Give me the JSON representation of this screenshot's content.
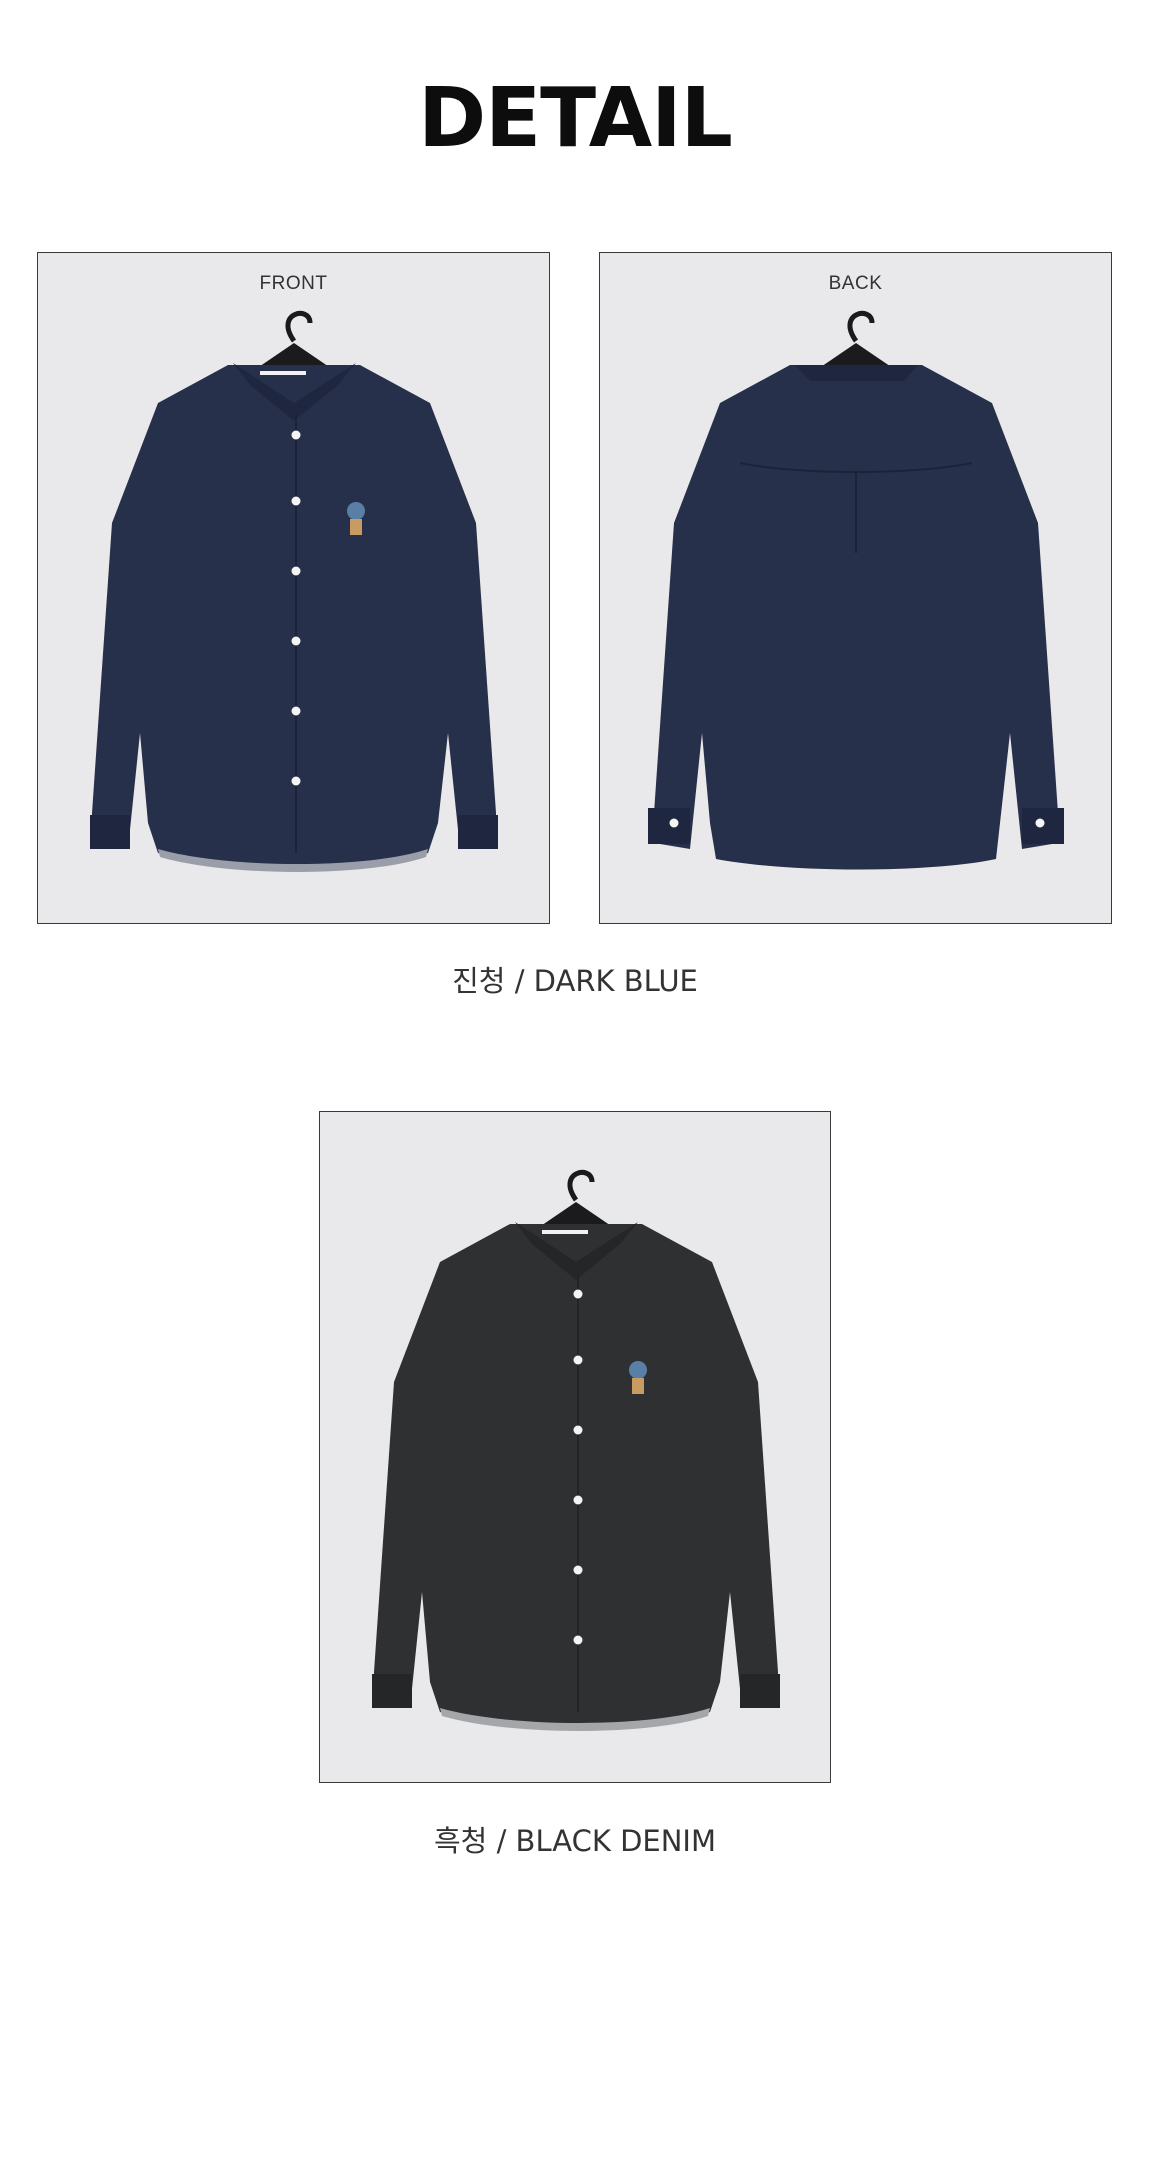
{
  "header": {
    "title": "DETAIL"
  },
  "sections": [
    {
      "views": [
        {
          "label": "FRONT",
          "image": "dark-blue-shirt-front"
        },
        {
          "label": "BACK",
          "image": "dark-blue-shirt-back"
        }
      ],
      "caption": "진청 / DARK BLUE",
      "fabric_color": "#27304a"
    },
    {
      "views": [
        {
          "label": "",
          "image": "black-denim-shirt-front"
        }
      ],
      "caption": "흑청 / BLACK DENIM",
      "fabric_color": "#2f3032"
    }
  ]
}
